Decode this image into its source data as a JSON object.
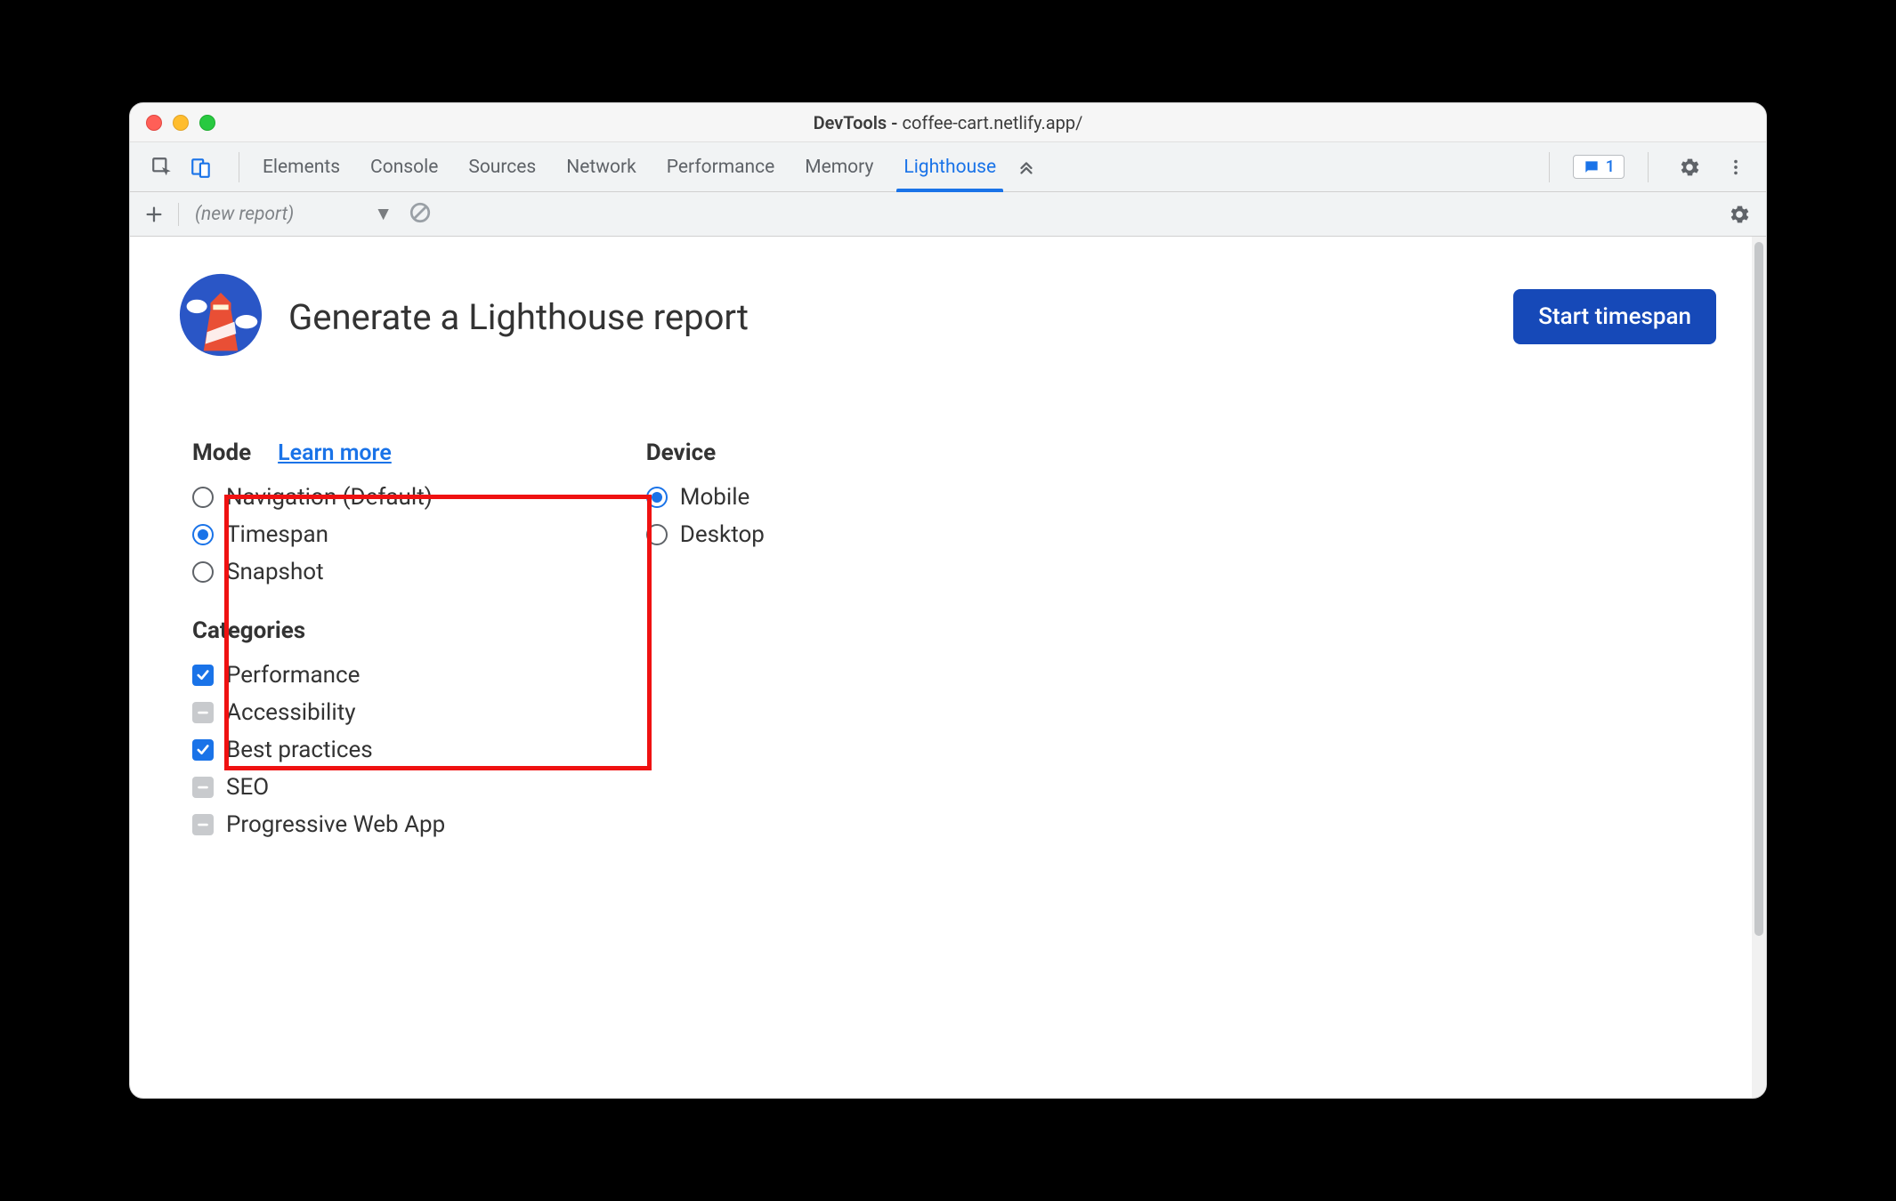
{
  "window": {
    "title_prefix": "DevTools - ",
    "title_url": "coffee-cart.netlify.app/"
  },
  "tabs": {
    "items": [
      "Elements",
      "Console",
      "Sources",
      "Network",
      "Performance",
      "Memory",
      "Lighthouse"
    ],
    "active_index": 6
  },
  "tabbar_right": {
    "badge_count": "1"
  },
  "subbar": {
    "report_placeholder": "(new report)"
  },
  "header": {
    "title": "Generate a Lighthouse report",
    "cta": "Start timespan"
  },
  "mode": {
    "label": "Mode",
    "learn_more": "Learn more",
    "options": [
      {
        "label": "Navigation (Default)",
        "selected": false
      },
      {
        "label": "Timespan",
        "selected": true
      },
      {
        "label": "Snapshot",
        "selected": false
      }
    ]
  },
  "device": {
    "label": "Device",
    "options": [
      {
        "label": "Mobile",
        "selected": true
      },
      {
        "label": "Desktop",
        "selected": false
      }
    ]
  },
  "categories": {
    "label": "Categories",
    "items": [
      {
        "label": "Performance",
        "state": "checked"
      },
      {
        "label": "Accessibility",
        "state": "indeterminate"
      },
      {
        "label": "Best practices",
        "state": "checked"
      },
      {
        "label": "SEO",
        "state": "indeterminate"
      },
      {
        "label": "Progressive Web App",
        "state": "indeterminate"
      }
    ]
  }
}
